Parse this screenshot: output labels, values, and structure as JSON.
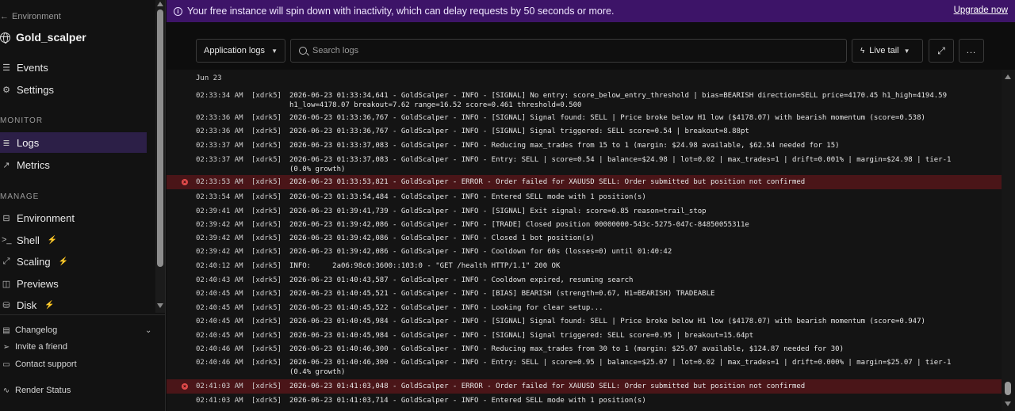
{
  "sidebar": {
    "back_label": "Environment",
    "service_name": "Gold_scalper",
    "top_items": [
      {
        "label": "Events",
        "icon": "list-icon"
      },
      {
        "label": "Settings",
        "icon": "gear-icon"
      }
    ],
    "monitor_title": "MONITOR",
    "monitor_items": [
      {
        "label": "Logs",
        "icon": "logs-icon",
        "active": true
      },
      {
        "label": "Metrics",
        "icon": "metrics-icon"
      }
    ],
    "manage_title": "MANAGE",
    "manage_items": [
      {
        "label": "Environment",
        "icon": "environment-icon"
      },
      {
        "label": "Shell",
        "icon": "shell-icon",
        "upgrade": true
      },
      {
        "label": "Scaling",
        "icon": "scaling-icon",
        "upgrade": true
      },
      {
        "label": "Previews",
        "icon": "previews-icon"
      },
      {
        "label": "Disk",
        "icon": "disk-icon",
        "upgrade": true
      }
    ],
    "footer": {
      "changelog": "Changelog",
      "invite": "Invite a friend",
      "support": "Contact support",
      "status": "Render Status"
    }
  },
  "banner": {
    "message": "Your free instance will spin down with inactivity, which can delay requests by 50 seconds or more.",
    "upgrade_label": "Upgrade now",
    "color": "#3d1468"
  },
  "toolbar": {
    "log_source": "Application logs",
    "search_placeholder": "Search logs",
    "live_tail_label": "Live tail",
    "more_label": "..."
  },
  "logs": {
    "date": "Jun 23",
    "error_color": "#4a1518",
    "rows": [
      {
        "time": "02:33:34 AM",
        "instance": "[xdrk5]",
        "message": "2026-06-23 01:33:34,641 - GoldScalper - INFO - [SIGNAL] No entry: score_below_entry_threshold | bias=BEARISH direction=SELL price=4170.45 h1_high=4194.59 h1_low=4178.07 breakout=7.62 range=16.52 score=0.461 threshold=0.500",
        "error": false
      },
      {
        "time": "02:33:36 AM",
        "instance": "[xdrk5]",
        "message": "2026-06-23 01:33:36,767 - GoldScalper - INFO - [SIGNAL] Signal found: SELL | Price broke below H1 low ($4178.07) with bearish momentum (score=0.538)",
        "error": false
      },
      {
        "time": "02:33:36 AM",
        "instance": "[xdrk5]",
        "message": "2026-06-23 01:33:36,767 - GoldScalper - INFO - [SIGNAL] Signal triggered: SELL score=0.54 | breakout=8.88pt",
        "error": false
      },
      {
        "time": "02:33:37 AM",
        "instance": "[xdrk5]",
        "message": "2026-06-23 01:33:37,083 - GoldScalper - INFO - Reducing max_trades from 15 to 1 (margin: $24.98 available, $62.54 needed for 15)",
        "error": false
      },
      {
        "time": "02:33:37 AM",
        "instance": "[xdrk5]",
        "message": "2026-06-23 01:33:37,083 - GoldScalper - INFO - Entry: SELL | score=0.54 | balance=$24.98 | lot=0.02 | max_trades=1 | drift=0.001% | margin=$24.98 | tier-1 (0.0% growth)",
        "error": false
      },
      {
        "time": "02:33:53 AM",
        "instance": "[xdrk5]",
        "message": "2026-06-23 01:33:53,821 - GoldScalper - ERROR - Order failed for XAUUSD SELL: Order submitted but position not confirmed",
        "error": true
      },
      {
        "time": "02:33:54 AM",
        "instance": "[xdrk5]",
        "message": "2026-06-23 01:33:54,484 - GoldScalper - INFO - Entered SELL mode with 1 position(s)",
        "error": false
      },
      {
        "time": "02:39:41 AM",
        "instance": "[xdrk5]",
        "message": "2026-06-23 01:39:41,739 - GoldScalper - INFO - [SIGNAL] Exit signal: score=0.85 reason=trail_stop",
        "error": false
      },
      {
        "time": "02:39:42 AM",
        "instance": "[xdrk5]",
        "message": "2026-06-23 01:39:42,086 - GoldScalper - INFO - [TRADE] Closed position 00000000-543c-5275-047c-84850055311e",
        "error": false
      },
      {
        "time": "02:39:42 AM",
        "instance": "[xdrk5]",
        "message": "2026-06-23 01:39:42,086 - GoldScalper - INFO - Closed 1 bot position(s)",
        "error": false
      },
      {
        "time": "02:39:42 AM",
        "instance": "[xdrk5]",
        "message": "2026-06-23 01:39:42,086 - GoldScalper - INFO - Cooldown for 60s (losses=0) until 01:40:42",
        "error": false
      },
      {
        "time": "02:40:12 AM",
        "instance": "[xdrk5]",
        "message": "INFO:     2a06:98c0:3600::103:0 - \"GET /health HTTP/1.1\" 200 OK",
        "error": false
      },
      {
        "time": "02:40:43 AM",
        "instance": "[xdrk5]",
        "message": "2026-06-23 01:40:43,587 - GoldScalper - INFO - Cooldown expired, resuming search",
        "error": false
      },
      {
        "time": "02:40:45 AM",
        "instance": "[xdrk5]",
        "message": "2026-06-23 01:40:45,521 - GoldScalper - INFO - [BIAS] BEARISH (strength=0.67, H1=BEARISH) TRADEABLE",
        "error": false
      },
      {
        "time": "02:40:45 AM",
        "instance": "[xdrk5]",
        "message": "2026-06-23 01:40:45,522 - GoldScalper - INFO - Looking for clear setup...",
        "error": false
      },
      {
        "time": "02:40:45 AM",
        "instance": "[xdrk5]",
        "message": "2026-06-23 01:40:45,984 - GoldScalper - INFO - [SIGNAL] Signal found: SELL | Price broke below H1 low ($4178.07) with bearish momentum (score=0.947)",
        "error": false
      },
      {
        "time": "02:40:45 AM",
        "instance": "[xdrk5]",
        "message": "2026-06-23 01:40:45,984 - GoldScalper - INFO - [SIGNAL] Signal triggered: SELL score=0.95 | breakout=15.64pt",
        "error": false
      },
      {
        "time": "02:40:46 AM",
        "instance": "[xdrk5]",
        "message": "2026-06-23 01:40:46,300 - GoldScalper - INFO - Reducing max_trades from 30 to 1 (margin: $25.07 available, $124.87 needed for 30)",
        "error": false
      },
      {
        "time": "02:40:46 AM",
        "instance": "[xdrk5]",
        "message": "2026-06-23 01:40:46,300 - GoldScalper - INFO - Entry: SELL | score=0.95 | balance=$25.07 | lot=0.02 | max_trades=1 | drift=0.000% | margin=$25.07 | tier-1 (0.4% growth)",
        "error": false
      },
      {
        "time": "02:41:03 AM",
        "instance": "[xdrk5]",
        "message": "2026-06-23 01:41:03,048 - GoldScalper - ERROR - Order failed for XAUUSD SELL: Order submitted but position not confirmed",
        "error": true
      },
      {
        "time": "02:41:03 AM",
        "instance": "[xdrk5]",
        "message": "2026-06-23 01:41:03,714 - GoldScalper - INFO - Entered SELL mode with 1 position(s)",
        "error": false
      }
    ]
  }
}
